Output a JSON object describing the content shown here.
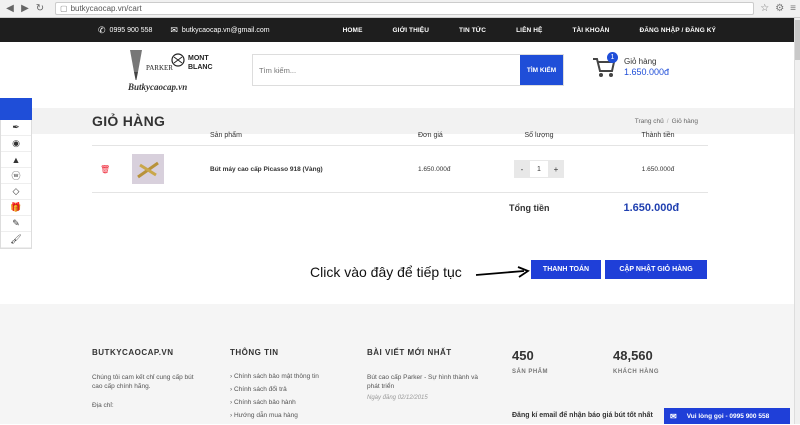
{
  "browser": {
    "url": "butkycaocap.vn/cart"
  },
  "topbar": {
    "phone": "0995 900 558",
    "email": "butkycaocap.vn@gmail.com",
    "menu": [
      "HOME",
      "GIỚI THIỆU",
      "TIN TỨC",
      "LIÊN HỆ",
      "TÀI KHOẢN",
      "ĐĂNG NHẬP / ĐĂNG KÝ"
    ]
  },
  "header": {
    "logo_brand_left": "PARKER",
    "logo_brand_right": "MONT BLANC",
    "logo_site": "Butkycaocap.vn",
    "search_placeholder": "Tìm kiếm...",
    "search_button": "TÌM KIẾM",
    "cart_count": "1",
    "cart_label": "Giỏ hàng",
    "cart_amount": "1.650.000đ"
  },
  "page": {
    "title": "GIỎ HÀNG",
    "breadcrumb": [
      "Trang chủ",
      "Giỏ hàng"
    ]
  },
  "cart": {
    "columns": [
      "Sản phẩm",
      "Đơn giá",
      "Số lượng",
      "Thành tiền"
    ],
    "items": [
      {
        "name": "Bút máy cao cấp Picasso 918 (Vàng)",
        "price": "1.650.000đ",
        "qty": "1",
        "total": "1.650.000đ"
      }
    ],
    "total_label": "Tổng tiền",
    "total_value": "1.650.000đ",
    "pay_button": "THANH TOÁN",
    "update_button": "CẬP NHẬT GIỎ HÀNG"
  },
  "instruction": "Click vào đây để tiếp tục",
  "footer": {
    "col1_title": "BUTKYCAOCAP.VN",
    "col1_text": "Chúng tôi cam kết chỉ cung cấp bút cao cấp chính hãng.",
    "col1_addr": "Địa chỉ:",
    "col2_title": "THÔNG TIN",
    "col2_links": [
      "Chính sách bảo mật thông tin",
      "Chính sách đổi trả",
      "Chính sách bảo hành",
      "Hướng dẫn mua hàng"
    ],
    "col3_title": "BÀI VIẾT MỚI NHẤT",
    "col3_post": "Bút cao cấp Parker - Sự hình thành và phát triển",
    "col3_date": "Ngày đăng 02/12/2015",
    "stat1_num": "450",
    "stat1_label": "SẢN PHẨM",
    "stat2_num": "48,560",
    "stat2_label": "KHÁCH HÀNG",
    "subscribe": "Đăng kí email để nhận báo giá bút tốt nhất",
    "call": "Vui lòng gọi - 0995 900 558"
  },
  "colors": {
    "accent": "#1f3fd8",
    "topbar": "#1e1e1e"
  }
}
